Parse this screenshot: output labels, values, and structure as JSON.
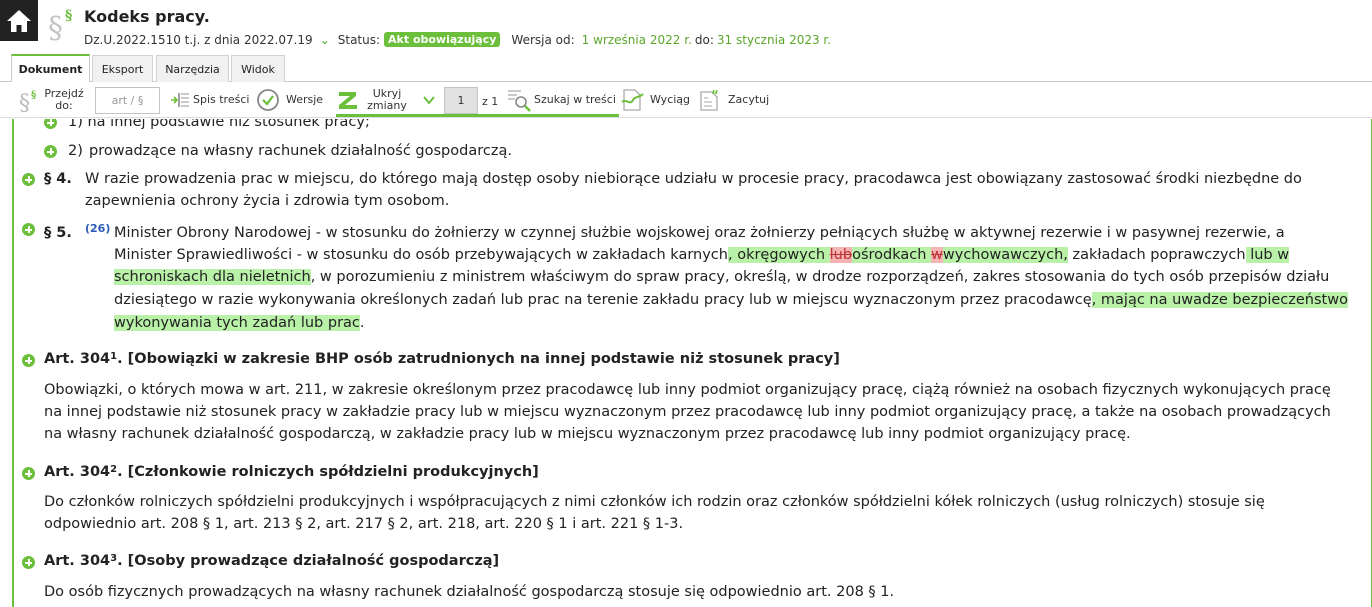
{
  "header": {
    "title": "Kodeks pracy.",
    "journal": "Dz.U.2022.1510 t.j. z dnia 2022.07.19",
    "status_label": "Status:",
    "status_value": "Akt obowiązujący",
    "version_label": "Wersja od:",
    "version_from": "1 września 2022 r.",
    "version_to_label": "do:",
    "version_to": "31 stycznia 2023 r."
  },
  "tabs": [
    "Dokument",
    "Eksport",
    "Narzędzia",
    "Widok"
  ],
  "toolbar": {
    "goto_label": "Przejdź do:",
    "art_placeholder": "art / §",
    "toc_label": "Spis treści",
    "versions_label": "Wersje",
    "hide_changes_label": "Ukryj zmiany",
    "page_value": "1",
    "page_of": "z 1",
    "search_label": "Szukaj w treści",
    "extract_label": "Wyciąg",
    "cite_label": "Zacytuj"
  },
  "content": {
    "item1": "1)  na innej podstawie niż stosunek pracy;",
    "item2_num": "2)",
    "item2_text": "prowadzące na własny rachunek działalność gospodarczą.",
    "p4_num": "§ 4.",
    "p4_line1": "W razie prowadzenia prac w miejscu, do którego mają dostęp osoby niebiorące udziału w procesie pracy, pracodawca jest obowiązany zastosować środki niezbędne do",
    "p4_line2": "zapewnienia ochrony życia i zdrowia tym osobom.",
    "p5_num": "§ 5.",
    "p5_footnote": "(26)",
    "p5_l1": "Minister Obrony Narodowej - w stosunku do żołnierzy w czynnej służbie wojskowej oraz żołnierzy pełniących służbę w aktywnej rezerwie i w pasywnej rezerwie, a",
    "p5_l2a": "Minister Sprawiedliwości - w stosunku do osób przebywających w zakładach karnych",
    "p5_l2b": ", okręgowych ",
    "p5_l2c": "lub",
    "p5_l2d": "ośrodkach ",
    "p5_l2e": "w",
    "p5_l2f": "wychowawczych,",
    "p5_l2g": " zakładach poprawczych",
    "p5_l2h": " lub w",
    "p5_l3a": "schroniskach dla nieletnich",
    "p5_l3b": ", w porozumieniu z ministrem właściwym do spraw pracy, określą, w drodze rozporządzeń, zakres stosowania do tych osób przepisów działu",
    "p5_l4a": "dziesiątego w razie wykonywania określonych zadań lub prac na terenie zakładu pracy lub w miejscu wyznaczonym przez pracodawcę",
    "p5_l4b": ", mając na uwadze bezpieczeństwo",
    "p5_l5a": "wykonywania tych zadań lub prac",
    "p5_l5b": ".",
    "articles": [
      {
        "num": "Art.  304",
        "sup": "1",
        "title": ".   [Obowiązki w zakresie BHP osób zatrudnionych na innej podstawie niż stosunek pracy]",
        "lines": [
          "Obowiązki, o których mowa w art. 211, w zakresie określonym przez pracodawcę lub inny podmiot organizujący pracę, ciążą również na osobach fizycznych wykonujących pracę",
          "na innej podstawie niż stosunek pracy w zakładzie pracy lub w miejscu wyznaczonym przez pracodawcę lub inny podmiot organizujący pracę, a także na osobach prowadzących",
          "na własny rachunek działalność gospodarczą, w zakładzie pracy lub w miejscu wyznaczonym przez pracodawcę lub inny podmiot organizujący pracę."
        ]
      },
      {
        "num": "Art.  304",
        "sup": "2",
        "title": ".   [Członkowie rolniczych spółdzielni produkcyjnych]",
        "lines": [
          "Do członków rolniczych spółdzielni produkcyjnych i współpracujących z nimi członków ich rodzin oraz członków spółdzielni kółek rolniczych (usług rolniczych) stosuje się",
          "odpowiednio art. 208 § 1, art. 213 § 2, art. 217 § 2, art. 218, art. 220 § 1 i art. 221 § 1-3."
        ]
      },
      {
        "num": "Art.  304",
        "sup": "3",
        "title": ".   [Osoby prowadzące działalność gospodarczą]",
        "lines": [
          "Do osób fizycznych prowadzących na własny rachunek działalność gospodarczą stosuje się odpowiednio art. 208 § 1."
        ]
      }
    ]
  },
  "colors": {
    "accent": "#6cbf3a",
    "highlight_added": "#b9f1a8",
    "highlight_removed": "#f5b5b5",
    "footnote": "#2a5bb5"
  },
  "icons": [
    "home-icon",
    "paragraph-icon",
    "toc-icon",
    "versions-icon",
    "changes-icon",
    "chevron-down-icon",
    "search-text-icon",
    "extract-icon",
    "cite-icon"
  ]
}
